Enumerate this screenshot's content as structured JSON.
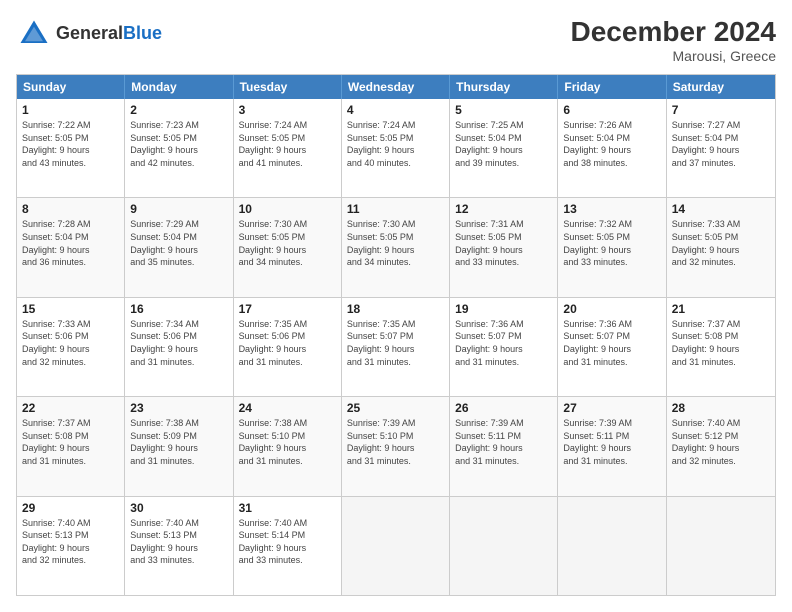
{
  "header": {
    "logo_general": "General",
    "logo_blue": "Blue",
    "month_year": "December 2024",
    "location": "Marousi, Greece"
  },
  "days_of_week": [
    "Sunday",
    "Monday",
    "Tuesday",
    "Wednesday",
    "Thursday",
    "Friday",
    "Saturday"
  ],
  "weeks": [
    [
      {
        "day": "1",
        "lines": [
          "Sunrise: 7:22 AM",
          "Sunset: 5:05 PM",
          "Daylight: 9 hours",
          "and 43 minutes."
        ]
      },
      {
        "day": "2",
        "lines": [
          "Sunrise: 7:23 AM",
          "Sunset: 5:05 PM",
          "Daylight: 9 hours",
          "and 42 minutes."
        ]
      },
      {
        "day": "3",
        "lines": [
          "Sunrise: 7:24 AM",
          "Sunset: 5:05 PM",
          "Daylight: 9 hours",
          "and 41 minutes."
        ]
      },
      {
        "day": "4",
        "lines": [
          "Sunrise: 7:24 AM",
          "Sunset: 5:05 PM",
          "Daylight: 9 hours",
          "and 40 minutes."
        ]
      },
      {
        "day": "5",
        "lines": [
          "Sunrise: 7:25 AM",
          "Sunset: 5:04 PM",
          "Daylight: 9 hours",
          "and 39 minutes."
        ]
      },
      {
        "day": "6",
        "lines": [
          "Sunrise: 7:26 AM",
          "Sunset: 5:04 PM",
          "Daylight: 9 hours",
          "and 38 minutes."
        ]
      },
      {
        "day": "7",
        "lines": [
          "Sunrise: 7:27 AM",
          "Sunset: 5:04 PM",
          "Daylight: 9 hours",
          "and 37 minutes."
        ]
      }
    ],
    [
      {
        "day": "8",
        "lines": [
          "Sunrise: 7:28 AM",
          "Sunset: 5:04 PM",
          "Daylight: 9 hours",
          "and 36 minutes."
        ]
      },
      {
        "day": "9",
        "lines": [
          "Sunrise: 7:29 AM",
          "Sunset: 5:04 PM",
          "Daylight: 9 hours",
          "and 35 minutes."
        ]
      },
      {
        "day": "10",
        "lines": [
          "Sunrise: 7:30 AM",
          "Sunset: 5:05 PM",
          "Daylight: 9 hours",
          "and 34 minutes."
        ]
      },
      {
        "day": "11",
        "lines": [
          "Sunrise: 7:30 AM",
          "Sunset: 5:05 PM",
          "Daylight: 9 hours",
          "and 34 minutes."
        ]
      },
      {
        "day": "12",
        "lines": [
          "Sunrise: 7:31 AM",
          "Sunset: 5:05 PM",
          "Daylight: 9 hours",
          "and 33 minutes."
        ]
      },
      {
        "day": "13",
        "lines": [
          "Sunrise: 7:32 AM",
          "Sunset: 5:05 PM",
          "Daylight: 9 hours",
          "and 33 minutes."
        ]
      },
      {
        "day": "14",
        "lines": [
          "Sunrise: 7:33 AM",
          "Sunset: 5:05 PM",
          "Daylight: 9 hours",
          "and 32 minutes."
        ]
      }
    ],
    [
      {
        "day": "15",
        "lines": [
          "Sunrise: 7:33 AM",
          "Sunset: 5:06 PM",
          "Daylight: 9 hours",
          "and 32 minutes."
        ]
      },
      {
        "day": "16",
        "lines": [
          "Sunrise: 7:34 AM",
          "Sunset: 5:06 PM",
          "Daylight: 9 hours",
          "and 31 minutes."
        ]
      },
      {
        "day": "17",
        "lines": [
          "Sunrise: 7:35 AM",
          "Sunset: 5:06 PM",
          "Daylight: 9 hours",
          "and 31 minutes."
        ]
      },
      {
        "day": "18",
        "lines": [
          "Sunrise: 7:35 AM",
          "Sunset: 5:07 PM",
          "Daylight: 9 hours",
          "and 31 minutes."
        ]
      },
      {
        "day": "19",
        "lines": [
          "Sunrise: 7:36 AM",
          "Sunset: 5:07 PM",
          "Daylight: 9 hours",
          "and 31 minutes."
        ]
      },
      {
        "day": "20",
        "lines": [
          "Sunrise: 7:36 AM",
          "Sunset: 5:07 PM",
          "Daylight: 9 hours",
          "and 31 minutes."
        ]
      },
      {
        "day": "21",
        "lines": [
          "Sunrise: 7:37 AM",
          "Sunset: 5:08 PM",
          "Daylight: 9 hours",
          "and 31 minutes."
        ]
      }
    ],
    [
      {
        "day": "22",
        "lines": [
          "Sunrise: 7:37 AM",
          "Sunset: 5:08 PM",
          "Daylight: 9 hours",
          "and 31 minutes."
        ]
      },
      {
        "day": "23",
        "lines": [
          "Sunrise: 7:38 AM",
          "Sunset: 5:09 PM",
          "Daylight: 9 hours",
          "and 31 minutes."
        ]
      },
      {
        "day": "24",
        "lines": [
          "Sunrise: 7:38 AM",
          "Sunset: 5:10 PM",
          "Daylight: 9 hours",
          "and 31 minutes."
        ]
      },
      {
        "day": "25",
        "lines": [
          "Sunrise: 7:39 AM",
          "Sunset: 5:10 PM",
          "Daylight: 9 hours",
          "and 31 minutes."
        ]
      },
      {
        "day": "26",
        "lines": [
          "Sunrise: 7:39 AM",
          "Sunset: 5:11 PM",
          "Daylight: 9 hours",
          "and 31 minutes."
        ]
      },
      {
        "day": "27",
        "lines": [
          "Sunrise: 7:39 AM",
          "Sunset: 5:11 PM",
          "Daylight: 9 hours",
          "and 31 minutes."
        ]
      },
      {
        "day": "28",
        "lines": [
          "Sunrise: 7:40 AM",
          "Sunset: 5:12 PM",
          "Daylight: 9 hours",
          "and 32 minutes."
        ]
      }
    ],
    [
      {
        "day": "29",
        "lines": [
          "Sunrise: 7:40 AM",
          "Sunset: 5:13 PM",
          "Daylight: 9 hours",
          "and 32 minutes."
        ]
      },
      {
        "day": "30",
        "lines": [
          "Sunrise: 7:40 AM",
          "Sunset: 5:13 PM",
          "Daylight: 9 hours",
          "and 33 minutes."
        ]
      },
      {
        "day": "31",
        "lines": [
          "Sunrise: 7:40 AM",
          "Sunset: 5:14 PM",
          "Daylight: 9 hours",
          "and 33 minutes."
        ]
      },
      {
        "day": "",
        "lines": []
      },
      {
        "day": "",
        "lines": []
      },
      {
        "day": "",
        "lines": []
      },
      {
        "day": "",
        "lines": []
      }
    ]
  ]
}
